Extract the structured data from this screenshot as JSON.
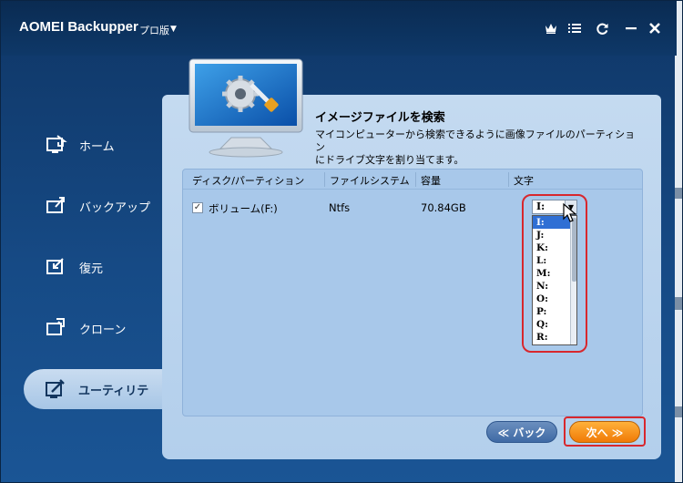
{
  "app": {
    "title": "AOMEI Backupper",
    "edition": "プロ版",
    "edition_caret": "▼"
  },
  "titlebar_icons": [
    "crown-icon",
    "menu-icon",
    "refresh-icon",
    "minimize-icon",
    "close-icon"
  ],
  "sidebar": {
    "items": [
      {
        "label": "ホーム",
        "icon": "home-icon",
        "active": false
      },
      {
        "label": "バックアップ",
        "icon": "backup-icon",
        "active": false
      },
      {
        "label": "復元",
        "icon": "restore-icon",
        "active": false
      },
      {
        "label": "クローン",
        "icon": "clone-icon",
        "active": false
      },
      {
        "label": "ユーティリテ",
        "icon": "utilities-icon",
        "active": true
      }
    ]
  },
  "main": {
    "heading": "イメージファイルを検索",
    "description_line1": "マイコンピューターから検索できるように画像ファイルのパーティション",
    "description_line2": "にドライブ文字を割り当てます。",
    "table": {
      "columns": [
        "ディスク/パーティション",
        "ファイルシステム",
        "容量",
        "文字"
      ],
      "rows": [
        {
          "checked": true,
          "name": "ボリューム(F:)",
          "filesystem": "Ntfs",
          "capacity": "70.84GB",
          "letter": "I:"
        }
      ]
    },
    "letter_dropdown": {
      "selected": "I:",
      "options": [
        "I:",
        "J:",
        "K:",
        "L:",
        "M:",
        "N:",
        "O:",
        "P:",
        "Q:",
        "R:"
      ]
    }
  },
  "footer": {
    "back_label": "≪ バック",
    "next_label": "次へ ≫"
  },
  "colors": {
    "accent_highlight": "#d8272d",
    "next_button": "#f58a12",
    "back_button": "#4a74ad",
    "panel": "#bcd6ee"
  }
}
